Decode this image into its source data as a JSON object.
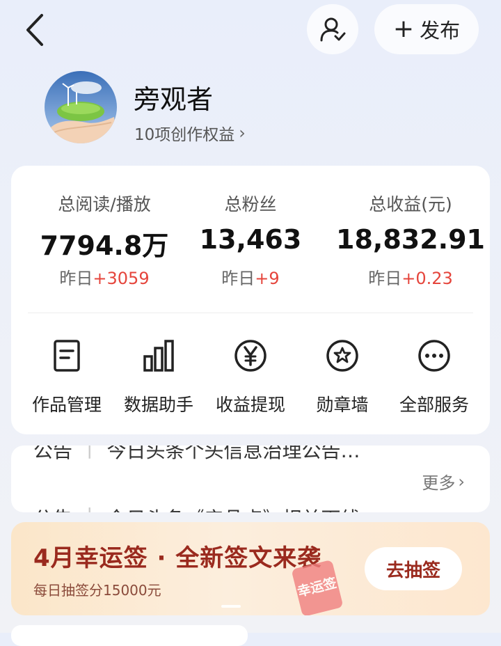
{
  "header": {
    "back_icon": "chevron-left-icon",
    "follow_icon": "user-check-icon",
    "publish_label": "发布"
  },
  "profile": {
    "name": "旁观者",
    "rights_text": "10项创作权益"
  },
  "stats": [
    {
      "label": "总阅读/播放",
      "value": "7794.8万",
      "delta_prefix": "昨日",
      "delta": "+3059"
    },
    {
      "label": "总粉丝",
      "value": "13,463",
      "delta_prefix": "昨日",
      "delta": "+9"
    },
    {
      "label": "总收益(元)",
      "value": "18,832.91",
      "delta_prefix": "昨日",
      "delta": "+0.23"
    }
  ],
  "services": [
    {
      "label": "作品管理",
      "icon": "document-icon"
    },
    {
      "label": "数据助手",
      "icon": "bar-chart-icon"
    },
    {
      "label": "收益提现",
      "icon": "yen-icon"
    },
    {
      "label": "勋章墙",
      "icon": "badge-icon"
    },
    {
      "label": "全部服务",
      "icon": "more-icon"
    }
  ],
  "notices": {
    "items": [
      {
        "tag": "公告",
        "text": "今日头条个头信息治理公告…"
      },
      {
        "tag": "公告",
        "text": "今日头条《产品点》相关下线…"
      }
    ],
    "more_label": "更多"
  },
  "promo": {
    "title": "4月幸运签 · 全新签文来袭",
    "subtitle": "每日抽签分15000元",
    "button_label": "去抽签",
    "tag_text": "幸运签"
  },
  "colors": {
    "accent_red": "#e5453c",
    "promo_title": "#9a2a1e"
  }
}
